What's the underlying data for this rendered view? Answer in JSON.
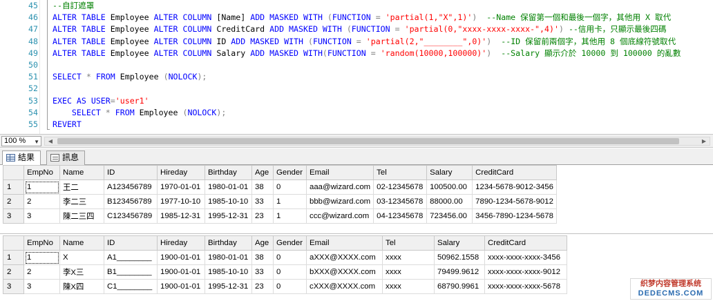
{
  "editor": {
    "lines": [
      {
        "num": "45",
        "tokens": [
          {
            "t": "--自訂遮罩",
            "c": "cm"
          }
        ]
      },
      {
        "num": "46",
        "tokens": [
          {
            "t": "ALTER TABLE ",
            "c": "kw"
          },
          {
            "t": "Employee ",
            "c": "tx"
          },
          {
            "t": "ALTER COLUMN ",
            "c": "kw"
          },
          {
            "t": "[Name] ",
            "c": "tx"
          },
          {
            "t": "ADD MASKED WITH ",
            "c": "kw"
          },
          {
            "t": "(",
            "c": "pn"
          },
          {
            "t": "FUNCTION ",
            "c": "kw"
          },
          {
            "t": "= ",
            "c": "pn"
          },
          {
            "t": "'partial(1,\"X\",1)'",
            "c": "str"
          },
          {
            "t": ")  ",
            "c": "pn"
          },
          {
            "t": "--Name 保留第一個和最後一個字，其他用 X 取代",
            "c": "cm"
          }
        ]
      },
      {
        "num": "47",
        "tokens": [
          {
            "t": "ALTER TABLE ",
            "c": "kw"
          },
          {
            "t": "Employee ",
            "c": "tx"
          },
          {
            "t": "ALTER COLUMN ",
            "c": "kw"
          },
          {
            "t": "CreditCard ",
            "c": "tx"
          },
          {
            "t": "ADD MASKED WITH ",
            "c": "kw"
          },
          {
            "t": "(",
            "c": "pn"
          },
          {
            "t": "FUNCTION ",
            "c": "kw"
          },
          {
            "t": "= ",
            "c": "pn"
          },
          {
            "t": "'partial(0,\"xxxx-xxxx-xxxx-\",4)'",
            "c": "str"
          },
          {
            "t": ") ",
            "c": "pn"
          },
          {
            "t": "--信用卡，只顯示最後四碼",
            "c": "cm"
          }
        ]
      },
      {
        "num": "48",
        "tokens": [
          {
            "t": "ALTER TABLE ",
            "c": "kw"
          },
          {
            "t": "Employee ",
            "c": "tx"
          },
          {
            "t": "ALTER COLUMN ",
            "c": "kw"
          },
          {
            "t": "ID ",
            "c": "tx"
          },
          {
            "t": "ADD MASKED WITH ",
            "c": "kw"
          },
          {
            "t": "(",
            "c": "pn"
          },
          {
            "t": "FUNCTION ",
            "c": "kw"
          },
          {
            "t": "= ",
            "c": "pn"
          },
          {
            "t": "'partial(2,\"________\",0)'",
            "c": "str"
          },
          {
            "t": ")  ",
            "c": "pn"
          },
          {
            "t": "--ID 保留前兩個字，其他用 8 個底線符號取代",
            "c": "cm"
          }
        ]
      },
      {
        "num": "49",
        "tokens": [
          {
            "t": "ALTER TABLE ",
            "c": "kw"
          },
          {
            "t": "Employee ",
            "c": "tx"
          },
          {
            "t": "ALTER COLUMN ",
            "c": "kw"
          },
          {
            "t": "Salary ",
            "c": "tx"
          },
          {
            "t": "ADD MASKED WITH",
            "c": "kw"
          },
          {
            "t": "(",
            "c": "pn"
          },
          {
            "t": "FUNCTION ",
            "c": "kw"
          },
          {
            "t": "= ",
            "c": "pn"
          },
          {
            "t": "'random(10000,100000)'",
            "c": "str"
          },
          {
            "t": ")  ",
            "c": "pn"
          },
          {
            "t": "--Salary 顯示介於 10000 到 100000 的亂數",
            "c": "cm"
          }
        ]
      },
      {
        "num": "50",
        "tokens": []
      },
      {
        "num": "51",
        "tokens": [
          {
            "t": "SELECT ",
            "c": "kw"
          },
          {
            "t": "* ",
            "c": "pn"
          },
          {
            "t": "FROM ",
            "c": "kw"
          },
          {
            "t": "Employee ",
            "c": "tx"
          },
          {
            "t": "(",
            "c": "pn"
          },
          {
            "t": "NOLOCK",
            "c": "kw"
          },
          {
            "t": ");",
            "c": "pn"
          }
        ]
      },
      {
        "num": "52",
        "tokens": []
      },
      {
        "num": "53",
        "tokens": [
          {
            "t": "EXEC AS USER",
            "c": "kw"
          },
          {
            "t": "=",
            "c": "pn"
          },
          {
            "t": "'user1'",
            "c": "str"
          }
        ]
      },
      {
        "num": "54",
        "tokens": [
          {
            "t": "    SELECT ",
            "c": "kw"
          },
          {
            "t": "* ",
            "c": "pn"
          },
          {
            "t": "FROM ",
            "c": "kw"
          },
          {
            "t": "Employee ",
            "c": "tx"
          },
          {
            "t": "(",
            "c": "pn"
          },
          {
            "t": "NOLOCK",
            "c": "kw"
          },
          {
            "t": ");",
            "c": "pn"
          }
        ]
      },
      {
        "num": "55",
        "tokens": [
          {
            "t": "REVERT",
            "c": "kw"
          }
        ]
      }
    ]
  },
  "zoom": {
    "value": "100 %"
  },
  "tabs": [
    {
      "label": "結果",
      "icon": "grid-icon",
      "active": true
    },
    {
      "label": "訊息",
      "icon": "message-icon",
      "active": false
    }
  ],
  "grid1": {
    "columns": [
      "EmpNo",
      "Name",
      "ID",
      "Hireday",
      "Birthday",
      "Age",
      "Gender",
      "Email",
      "Tel",
      "Salary",
      "CreditCard"
    ],
    "rows": [
      {
        "num": "1",
        "cells": [
          "1",
          "王二",
          "A123456789",
          "1970-01-01",
          "1980-01-01",
          "38",
          "0",
          "aaa@wizard.com",
          "02-12345678",
          "100500.00",
          "1234-5678-9012-3456"
        ]
      },
      {
        "num": "2",
        "cells": [
          "2",
          "李二三",
          "B123456789",
          "1977-10-10",
          "1985-10-10",
          "33",
          "1",
          "bbb@wizard.com",
          "03-12345678",
          "88000.00",
          "7890-1234-5678-9012"
        ]
      },
      {
        "num": "3",
        "cells": [
          "3",
          "陳二三四",
          "C123456789",
          "1985-12-31",
          "1995-12-31",
          "23",
          "1",
          "ccc@wizard.com",
          "04-12345678",
          "723456.00",
          "3456-7890-1234-5678"
        ]
      }
    ]
  },
  "grid2": {
    "columns": [
      "EmpNo",
      "Name",
      "ID",
      "Hireday",
      "Birthday",
      "Age",
      "Gender",
      "Email",
      "Tel",
      "Salary",
      "CreditCard"
    ],
    "rows": [
      {
        "num": "1",
        "cells": [
          "1",
          "X",
          "A1________",
          "1900-01-01",
          "1980-01-01",
          "38",
          "0",
          "aXXX@XXXX.com",
          "xxxx",
          "50962.1558",
          "xxxx-xxxx-xxxx-3456"
        ]
      },
      {
        "num": "2",
        "cells": [
          "2",
          "李X三",
          "B1________",
          "1900-01-01",
          "1985-10-10",
          "33",
          "0",
          "bXXX@XXXX.com",
          "xxxx",
          "79499.9612",
          "xxxx-xxxx-xxxx-9012"
        ]
      },
      {
        "num": "3",
        "cells": [
          "3",
          "陳X四",
          "C1________",
          "1900-01-01",
          "1995-12-31",
          "23",
          "0",
          "cXXX@XXXX.com",
          "xxxx",
          "68790.9961",
          "xxxx-xxxx-xxxx-5678"
        ]
      }
    ]
  },
  "watermark": {
    "line1": "织梦内容管理系统",
    "line2": "DEDECMS.COM"
  }
}
